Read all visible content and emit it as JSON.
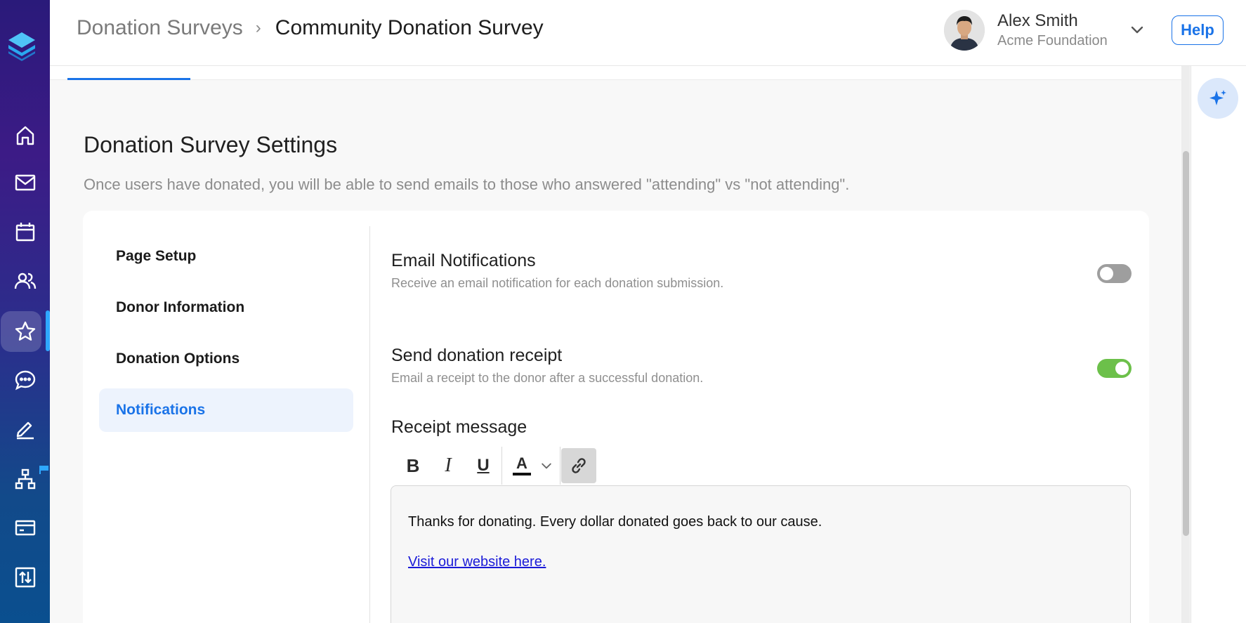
{
  "breadcrumb": {
    "parent": "Donation Surveys",
    "separator": "›",
    "current": "Community Donation Survey"
  },
  "user": {
    "name": "Alex Smith",
    "organization": "Acme Foundation"
  },
  "help_label": "Help",
  "page": {
    "title": "Donation Survey Settings",
    "description": "Once users have donated, you will be able to send emails to those who answered \"attending\" vs \"not attending\"."
  },
  "settings_menu": {
    "items": [
      {
        "label": "Page Setup",
        "active": false
      },
      {
        "label": "Donor Information",
        "active": false
      },
      {
        "label": "Donation Options",
        "active": false
      },
      {
        "label": "Notifications",
        "active": true
      }
    ]
  },
  "notifications": {
    "email": {
      "title": "Email Notifications",
      "description": "Receive an email notification for each donation submission.",
      "enabled": false
    },
    "receipt": {
      "title": "Send donation receipt",
      "description": "Email a receipt to the donor after a successful donation.",
      "enabled": true
    },
    "receipt_message": {
      "label": "Receipt message",
      "body": "Thanks for donating. Every dollar donated goes back to our cause.",
      "link_text": "Visit our website here."
    }
  },
  "toolbar": {
    "bold": "B",
    "italic": "I",
    "underline": "U",
    "text_color": "A"
  },
  "icons": {
    "nav": [
      "home-icon",
      "mail-icon",
      "calendar-icon",
      "people-icon",
      "star-icon",
      "chat-icon",
      "edit-icon",
      "org-chart-icon",
      "card-icon",
      "transfer-icon"
    ],
    "assistant": "sparkle-icon"
  },
  "colors": {
    "accent": "#1a73e8",
    "toggle_on": "#6cc04a",
    "toggle_off": "#9e9e9e",
    "active_nav_marker": "#2ea8ff"
  }
}
